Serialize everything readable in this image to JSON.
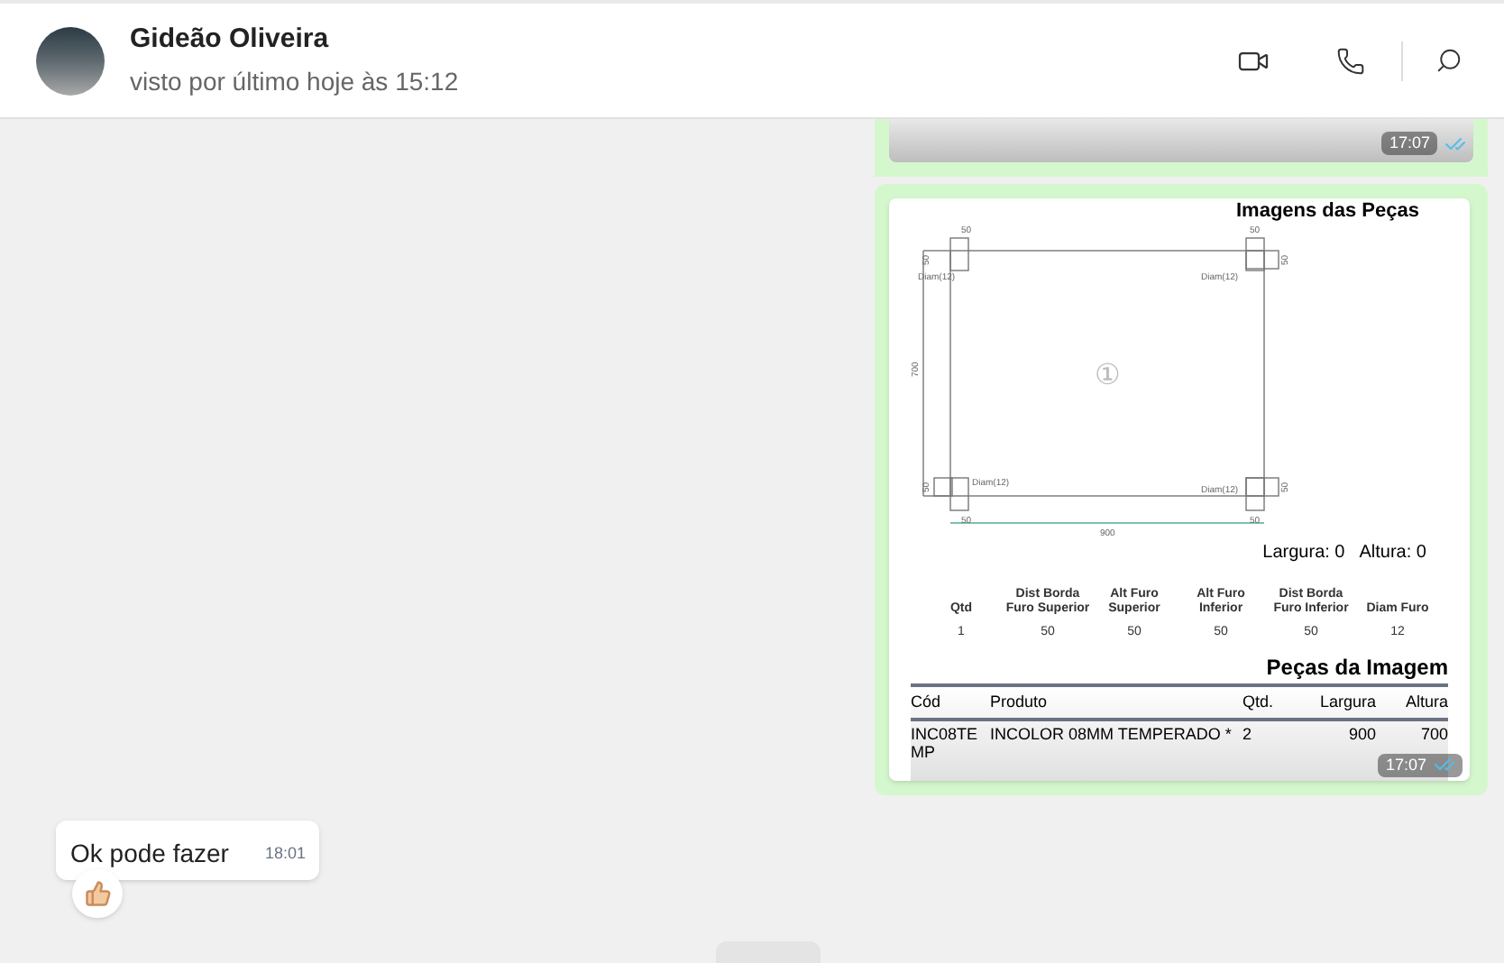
{
  "contact": {
    "name": "Gideão Oliveira",
    "status": "visto por último hoje às 15:12"
  },
  "messages": [
    {
      "kind": "image-tail",
      "time": "17:07",
      "read": true
    },
    {
      "kind": "document",
      "time": "17:07",
      "read": true,
      "document": {
        "title": "Imagens das Peças",
        "drawing_labels": [
          "50",
          "50",
          "50",
          "50",
          "50",
          "50",
          "50",
          "50",
          "Diam(12)",
          "Diam(12)",
          "Diam(12)",
          "Diam(12)",
          "700",
          "900",
          "①"
        ],
        "size_line": [
          "Largura: 0",
          "Altura: 0"
        ],
        "spec_columns": [
          "Qtd",
          "Dist Borda Furo Superior",
          "Alt Furo Superior",
          "Alt Furo Inferior",
          "Dist Borda Furo Inferior",
          "Diam Furo"
        ],
        "spec_values": [
          "1",
          "50",
          "50",
          "50",
          "50",
          "12"
        ],
        "pieces_title": "Peças da Imagem",
        "table": {
          "columns": [
            "Cód",
            "Produto",
            "Qtd.",
            "Largura",
            "Altura"
          ],
          "rows": [
            [
              "INC08TE MP",
              "INCOLOR 08MM TEMPERADO *",
              "2",
              "900",
              "700"
            ]
          ]
        }
      }
    },
    {
      "kind": "text",
      "text": "Ok pode fazer",
      "time": "18:01",
      "reaction": true
    }
  ]
}
